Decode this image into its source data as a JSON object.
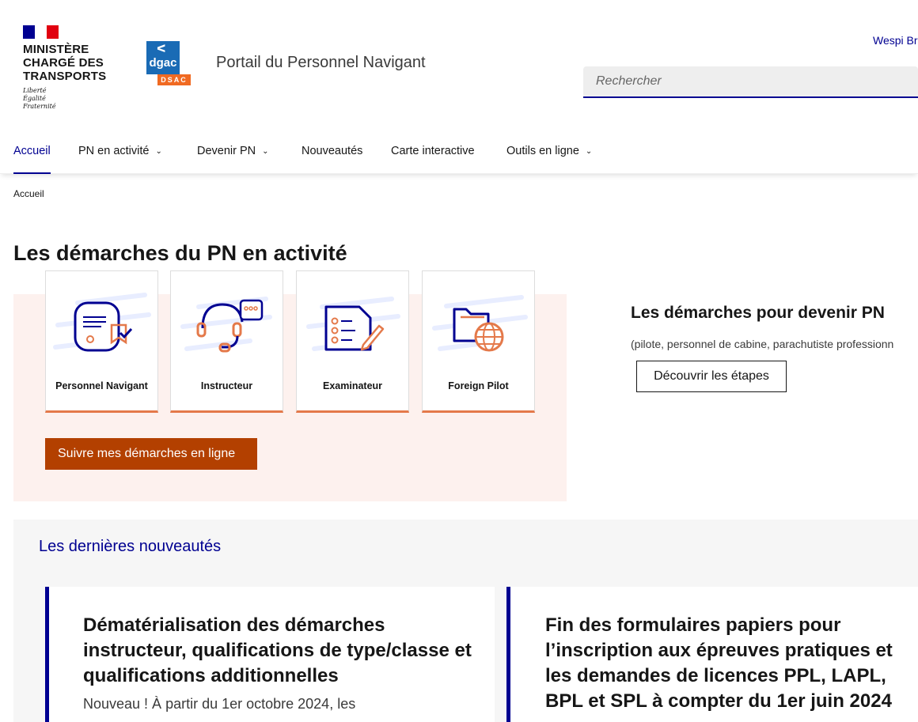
{
  "header": {
    "ministry": "MINISTÈRE\nCHARGÉ DES\nTRANSPORTS",
    "devise": "Liberté\nÉgalité\nFraternité",
    "dgac_logo_text": "dgac",
    "dsac_logo_text": "DSAC",
    "portal_title": "Portail du Personnel Navigant",
    "user_link": "Wespi Br",
    "search_placeholder": "Rechercher"
  },
  "nav": {
    "items": [
      {
        "label": "Accueil",
        "has_menu": false,
        "active": true
      },
      {
        "label": "PN en activité",
        "has_menu": true
      },
      {
        "label": "Devenir PN",
        "has_menu": true
      },
      {
        "label": "Nouveautés",
        "has_menu": false
      },
      {
        "label": "Carte interactive",
        "has_menu": false
      },
      {
        "label": "Outils en ligne",
        "has_menu": true
      }
    ],
    "chevron": "⌄"
  },
  "breadcrumb": "Accueil",
  "pn_activite": {
    "title": "Les démarches du PN en activité",
    "cards": [
      {
        "label": "Personnel Navigant",
        "icon": "document-check-icon"
      },
      {
        "label": "Instructeur",
        "icon": "headset-chat-icon"
      },
      {
        "label": "Examinateur",
        "icon": "checklist-pen-icon"
      },
      {
        "label": "Foreign Pilot",
        "icon": "folder-globe-icon"
      }
    ],
    "follow_button": "Suivre mes démarches en ligne"
  },
  "devenir_pn": {
    "title": "Les démarches pour devenir PN",
    "subtitle": "(pilote, personnel de cabine, parachutiste professionn",
    "button": "Découvrir les étapes"
  },
  "news": {
    "heading": "Les dernières nouveautés",
    "items": [
      {
        "title": "Dématérialisation des démarches instructeur, qualifications de type/classe et qualifications additionnelles",
        "desc": "Nouveau ! À partir du 1er octobre 2024, les"
      },
      {
        "title": "Fin des formulaires papiers pour l’inscription aux épreuves pratiques et les demandes de licences PPL, LAPL, BPL et SPL à compter du 1er juin 2024",
        "desc": ""
      }
    ]
  },
  "colors": {
    "primary_blue": "#000091",
    "accent_orange": "#e4794a",
    "button_brown": "#b34000",
    "card_bg_pink": "#fdf1ee"
  }
}
